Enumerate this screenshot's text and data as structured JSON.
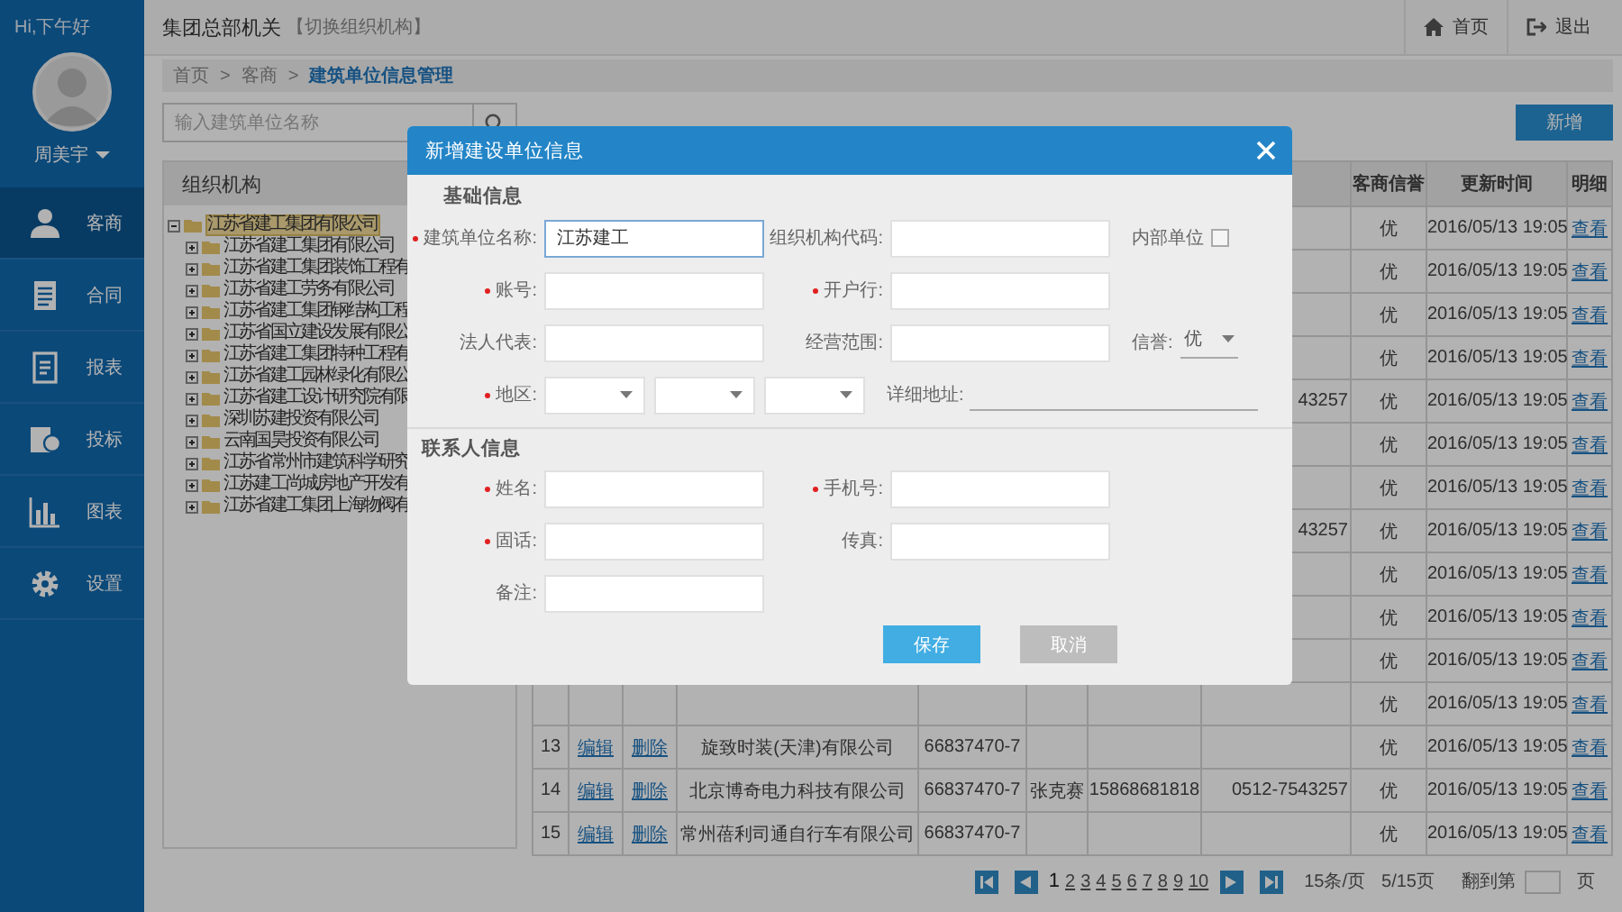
{
  "greeting": "Hi,下午好",
  "user": {
    "name": "周美宇"
  },
  "nav": [
    {
      "label": "客商",
      "selected": true
    },
    {
      "label": "合同",
      "selected": false
    },
    {
      "label": "报表",
      "selected": false
    },
    {
      "label": "投标",
      "selected": false
    },
    {
      "label": "图表",
      "selected": false
    },
    {
      "label": "设置",
      "selected": false
    }
  ],
  "topbar": {
    "org": "集团总部机关",
    "switch": "【切换组织机构】",
    "links": [
      "首页",
      "退出"
    ]
  },
  "breadcrumb": [
    {
      "label": "首页",
      "separator": ">",
      "current": false
    },
    {
      "label": "客商",
      "separator": ">",
      "current": false
    },
    {
      "label": "建筑单位信息管理",
      "current": true
    }
  ],
  "search": {
    "placeholder": "输入建筑单位名称"
  },
  "add_button": "新增",
  "tree": {
    "title": "组织机构",
    "root": {
      "label": "江苏省建工集团有限公司",
      "expanded": true,
      "selected": true,
      "children": [
        {
          "label": "江苏省建工集团有限公司",
          "expanded": false,
          "selected": false
        },
        {
          "label": "江苏省建工集团装饰工程有",
          "expanded": false,
          "selected": false
        },
        {
          "label": "江苏省建工劳务有限公司",
          "expanded": false,
          "selected": false
        },
        {
          "label": "江苏省建工集团钢结构工程",
          "expanded": false,
          "selected": false
        },
        {
          "label": "江苏省国立建设发展有限公",
          "expanded": false,
          "selected": false
        },
        {
          "label": "江苏省建工集团特种工程有",
          "expanded": false,
          "selected": false
        },
        {
          "label": "江苏省建工园林绿化有限公",
          "expanded": false,
          "selected": false
        },
        {
          "label": "江苏省建工设计研究院有限",
          "expanded": false,
          "selected": false
        },
        {
          "label": "深圳苏建投资有限公司",
          "expanded": false,
          "selected": false
        },
        {
          "label": "云南国昊投资有限公司",
          "expanded": false,
          "selected": false
        },
        {
          "label": "江苏省常州市建筑科学研究",
          "expanded": false,
          "selected": false
        },
        {
          "label": "江苏建工尚城房地产开发有",
          "expanded": false,
          "selected": false
        },
        {
          "label": "江苏省建工集团上海物阀有",
          "expanded": false,
          "selected": false
        }
      ]
    }
  },
  "table": {
    "headers": {
      "credit": "客商信誉",
      "updated": "更新时间",
      "detail": "明细"
    },
    "rows": [
      {
        "credit": "优",
        "updated": "2016/05/13 19:05",
        "detail": "查看"
      },
      {
        "credit": "优",
        "updated": "2016/05/13 19:05",
        "detail": "查看"
      },
      {
        "credit": "优",
        "updated": "2016/05/13 19:05",
        "detail": "查看"
      },
      {
        "credit": "优",
        "updated": "2016/05/13 19:05",
        "detail": "查看"
      },
      {
        "phone": "43257",
        "credit": "优",
        "updated": "2016/05/13 19:05",
        "detail": "查看"
      },
      {
        "credit": "优",
        "updated": "2016/05/13 19:05",
        "detail": "查看"
      },
      {
        "credit": "优",
        "updated": "2016/05/13 19:05",
        "detail": "查看"
      },
      {
        "phone": "43257",
        "credit": "优",
        "updated": "2016/05/13 19:05",
        "detail": "查看"
      },
      {
        "credit": "优",
        "updated": "2016/05/13 19:05",
        "detail": "查看"
      },
      {
        "credit": "优",
        "updated": "2016/05/13 19:05",
        "detail": "查看"
      },
      {
        "credit": "优",
        "updated": "2016/05/13 19:05",
        "detail": "查看"
      },
      {
        "credit": "优",
        "updated": "2016/05/13 19:05",
        "detail": "查看"
      },
      {
        "index": "13",
        "edit": "编辑",
        "delete": "删除",
        "company": "旋致时装(天津)有限公司",
        "org_code": "66837470-7",
        "credit": "优",
        "updated": "2016/05/13 19:05",
        "detail": "查看"
      },
      {
        "index": "14",
        "edit": "编辑",
        "delete": "删除",
        "company": "北京博奇电力科技有限公司",
        "org_code": "66837470-7",
        "contact": "张克赛",
        "mobile": "15868681818",
        "phone": "0512-7543257",
        "credit": "优",
        "updated": "2016/05/13 19:05",
        "detail": "查看"
      },
      {
        "index": "15",
        "edit": "编辑",
        "delete": "删除",
        "company": "常州蓓利司通自行车有限公司",
        "org_code": "66837470-7",
        "credit": "优",
        "updated": "2016/05/13 19:05",
        "detail": "查看"
      }
    ]
  },
  "pagination": {
    "pages": [
      {
        "label": "1",
        "selected": true
      },
      {
        "label": "2",
        "selected": false
      },
      {
        "label": "3",
        "selected": false
      },
      {
        "label": "4",
        "selected": false
      },
      {
        "label": "5",
        "selected": false
      },
      {
        "label": "6",
        "selected": false
      },
      {
        "label": "7",
        "selected": false
      },
      {
        "label": "8",
        "selected": false
      },
      {
        "label": "9",
        "selected": false
      },
      {
        "label": "10",
        "selected": false
      }
    ],
    "per_page": "15条/页",
    "position": "5/15页",
    "jump_label": "翻到第",
    "jump_suffix": "页"
  },
  "dialog": {
    "title": "新增建设单位信息",
    "sections": [
      {
        "title": "基础信息",
        "rows": [
          [
            {
              "kind": "text",
              "label": "建筑单位名称:",
              "required": true,
              "value": "江苏建工",
              "focused": true
            },
            {
              "kind": "text",
              "label": "组织机构代码:",
              "required": false,
              "focused": false
            },
            {
              "kind": "checkbox",
              "label": "内部单位",
              "checked": false
            }
          ],
          [
            {
              "kind": "text",
              "label": "账号:",
              "required": true,
              "focused": false
            },
            {
              "kind": "text",
              "label": "开户行:",
              "required": true,
              "focused": false
            }
          ],
          [
            {
              "kind": "text",
              "label": "法人代表:",
              "required": false,
              "focused": false
            },
            {
              "kind": "text",
              "label": "经营范围:",
              "required": false,
              "focused": false
            },
            {
              "kind": "select",
              "label": "信誉:",
              "value": "优"
            }
          ],
          [
            {
              "kind": "region",
              "label": "地区:",
              "required": true
            },
            {
              "kind": "address",
              "label": "详细地址:"
            }
          ]
        ]
      },
      {
        "title": "联系人信息",
        "rows": [
          [
            {
              "kind": "text",
              "label": "姓名:",
              "required": true,
              "focused": false
            },
            {
              "kind": "text",
              "label": "手机号:",
              "required": true,
              "focused": false
            }
          ],
          [
            {
              "kind": "text",
              "label": "固话:",
              "required": true,
              "focused": false
            },
            {
              "kind": "text",
              "label": "传真:",
              "required": false,
              "focused": false
            }
          ],
          [
            {
              "kind": "text",
              "label": "备注:",
              "required": false,
              "focused": false
            }
          ]
        ]
      }
    ],
    "buttons": [
      {
        "label": "保存",
        "disabled": false
      },
      {
        "label": "取消",
        "disabled": true
      }
    ]
  }
}
